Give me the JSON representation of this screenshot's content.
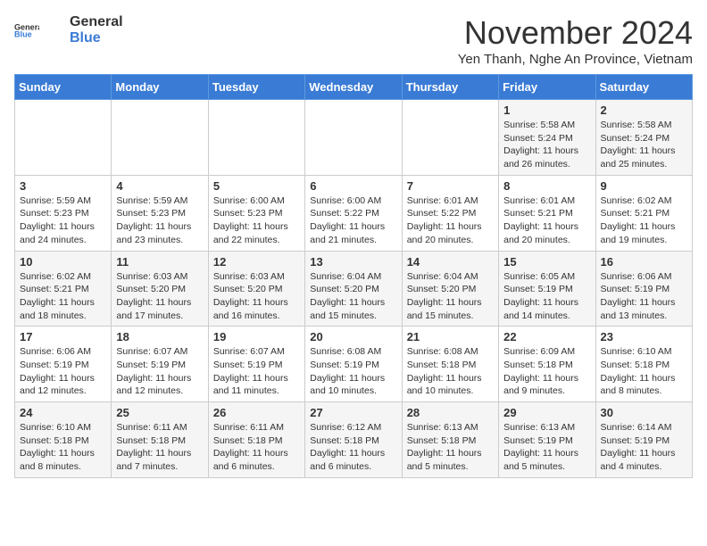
{
  "header": {
    "logo_general": "General",
    "logo_blue": "Blue",
    "month_title": "November 2024",
    "subtitle": "Yen Thanh, Nghe An Province, Vietnam"
  },
  "days_of_week": [
    "Sunday",
    "Monday",
    "Tuesday",
    "Wednesday",
    "Thursday",
    "Friday",
    "Saturday"
  ],
  "weeks": [
    [
      {
        "day": "",
        "info": ""
      },
      {
        "day": "",
        "info": ""
      },
      {
        "day": "",
        "info": ""
      },
      {
        "day": "",
        "info": ""
      },
      {
        "day": "",
        "info": ""
      },
      {
        "day": "1",
        "info": "Sunrise: 5:58 AM\nSunset: 5:24 PM\nDaylight: 11 hours and 26 minutes."
      },
      {
        "day": "2",
        "info": "Sunrise: 5:58 AM\nSunset: 5:24 PM\nDaylight: 11 hours and 25 minutes."
      }
    ],
    [
      {
        "day": "3",
        "info": "Sunrise: 5:59 AM\nSunset: 5:23 PM\nDaylight: 11 hours and 24 minutes."
      },
      {
        "day": "4",
        "info": "Sunrise: 5:59 AM\nSunset: 5:23 PM\nDaylight: 11 hours and 23 minutes."
      },
      {
        "day": "5",
        "info": "Sunrise: 6:00 AM\nSunset: 5:23 PM\nDaylight: 11 hours and 22 minutes."
      },
      {
        "day": "6",
        "info": "Sunrise: 6:00 AM\nSunset: 5:22 PM\nDaylight: 11 hours and 21 minutes."
      },
      {
        "day": "7",
        "info": "Sunrise: 6:01 AM\nSunset: 5:22 PM\nDaylight: 11 hours and 20 minutes."
      },
      {
        "day": "8",
        "info": "Sunrise: 6:01 AM\nSunset: 5:21 PM\nDaylight: 11 hours and 20 minutes."
      },
      {
        "day": "9",
        "info": "Sunrise: 6:02 AM\nSunset: 5:21 PM\nDaylight: 11 hours and 19 minutes."
      }
    ],
    [
      {
        "day": "10",
        "info": "Sunrise: 6:02 AM\nSunset: 5:21 PM\nDaylight: 11 hours and 18 minutes."
      },
      {
        "day": "11",
        "info": "Sunrise: 6:03 AM\nSunset: 5:20 PM\nDaylight: 11 hours and 17 minutes."
      },
      {
        "day": "12",
        "info": "Sunrise: 6:03 AM\nSunset: 5:20 PM\nDaylight: 11 hours and 16 minutes."
      },
      {
        "day": "13",
        "info": "Sunrise: 6:04 AM\nSunset: 5:20 PM\nDaylight: 11 hours and 15 minutes."
      },
      {
        "day": "14",
        "info": "Sunrise: 6:04 AM\nSunset: 5:20 PM\nDaylight: 11 hours and 15 minutes."
      },
      {
        "day": "15",
        "info": "Sunrise: 6:05 AM\nSunset: 5:19 PM\nDaylight: 11 hours and 14 minutes."
      },
      {
        "day": "16",
        "info": "Sunrise: 6:06 AM\nSunset: 5:19 PM\nDaylight: 11 hours and 13 minutes."
      }
    ],
    [
      {
        "day": "17",
        "info": "Sunrise: 6:06 AM\nSunset: 5:19 PM\nDaylight: 11 hours and 12 minutes."
      },
      {
        "day": "18",
        "info": "Sunrise: 6:07 AM\nSunset: 5:19 PM\nDaylight: 11 hours and 12 minutes."
      },
      {
        "day": "19",
        "info": "Sunrise: 6:07 AM\nSunset: 5:19 PM\nDaylight: 11 hours and 11 minutes."
      },
      {
        "day": "20",
        "info": "Sunrise: 6:08 AM\nSunset: 5:19 PM\nDaylight: 11 hours and 10 minutes."
      },
      {
        "day": "21",
        "info": "Sunrise: 6:08 AM\nSunset: 5:18 PM\nDaylight: 11 hours and 10 minutes."
      },
      {
        "day": "22",
        "info": "Sunrise: 6:09 AM\nSunset: 5:18 PM\nDaylight: 11 hours and 9 minutes."
      },
      {
        "day": "23",
        "info": "Sunrise: 6:10 AM\nSunset: 5:18 PM\nDaylight: 11 hours and 8 minutes."
      }
    ],
    [
      {
        "day": "24",
        "info": "Sunrise: 6:10 AM\nSunset: 5:18 PM\nDaylight: 11 hours and 8 minutes."
      },
      {
        "day": "25",
        "info": "Sunrise: 6:11 AM\nSunset: 5:18 PM\nDaylight: 11 hours and 7 minutes."
      },
      {
        "day": "26",
        "info": "Sunrise: 6:11 AM\nSunset: 5:18 PM\nDaylight: 11 hours and 6 minutes."
      },
      {
        "day": "27",
        "info": "Sunrise: 6:12 AM\nSunset: 5:18 PM\nDaylight: 11 hours and 6 minutes."
      },
      {
        "day": "28",
        "info": "Sunrise: 6:13 AM\nSunset: 5:18 PM\nDaylight: 11 hours and 5 minutes."
      },
      {
        "day": "29",
        "info": "Sunrise: 6:13 AM\nSunset: 5:19 PM\nDaylight: 11 hours and 5 minutes."
      },
      {
        "day": "30",
        "info": "Sunrise: 6:14 AM\nSunset: 5:19 PM\nDaylight: 11 hours and 4 minutes."
      }
    ]
  ]
}
